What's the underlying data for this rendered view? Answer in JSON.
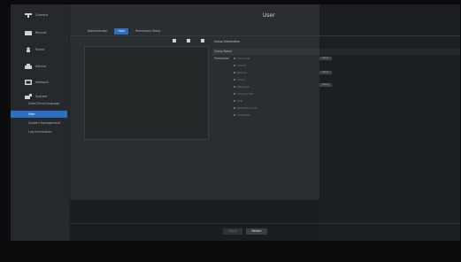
{
  "page_title": "User",
  "sidebar": {
    "items": [
      {
        "label": "Camera",
        "icon": "camera-icon"
      },
      {
        "label": "Record",
        "icon": "record-icon"
      },
      {
        "label": "Event",
        "icon": "event-icon"
      },
      {
        "label": "Device",
        "icon": "device-icon"
      },
      {
        "label": "Network",
        "icon": "network-icon"
      },
      {
        "label": "System",
        "icon": "system-icon"
      }
    ],
    "subitems": [
      {
        "label": "Date/Time/Language"
      },
      {
        "label": "User"
      },
      {
        "label": "System Management"
      },
      {
        "label": "Log Information"
      }
    ]
  },
  "tabs": [
    {
      "label": "Administrator"
    },
    {
      "label": "User"
    },
    {
      "label": "Permission Setup"
    }
  ],
  "group_info": {
    "heading": "Group Information",
    "group_name_label": "Group Name",
    "permission_label": "Permission",
    "permissions": [
      "Live View",
      "Search",
      "Backup",
      "Alarm",
      "Playback",
      "Camera Ctrl",
      "PTZ",
      "Remote Access",
      "Shutdown"
    ],
    "right_buttons": [
      "Setup",
      "Setup",
      "Setup"
    ]
  },
  "buttons": {
    "apply": "Apply",
    "return": "Return"
  },
  "colors": {
    "accent": "#2d6fc4",
    "panel": "#2b2e30"
  }
}
